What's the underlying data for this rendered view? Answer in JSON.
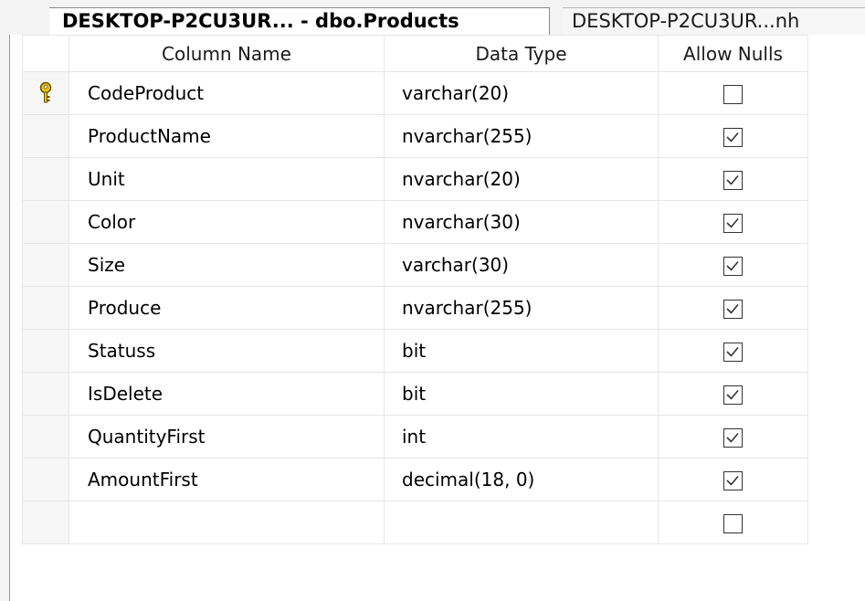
{
  "tabs": [
    {
      "label": "DESKTOP-P2CU3UR... - dbo.Products",
      "active": true
    },
    {
      "label": "DESKTOP-P2CU3UR...nh",
      "active": false
    }
  ],
  "columns": {
    "name_header": "Column Name",
    "type_header": "Data Type",
    "nulls_header": "Allow Nulls"
  },
  "rows": [
    {
      "name": "CodeProduct",
      "type": "varchar(20)",
      "allow_nulls": false,
      "primary_key": true,
      "key_icon": "primary-key-icon"
    },
    {
      "name": "ProductName",
      "type": "nvarchar(255)",
      "allow_nulls": true
    },
    {
      "name": "Unit",
      "type": "nvarchar(20)",
      "allow_nulls": true
    },
    {
      "name": "Color",
      "type": "nvarchar(30)",
      "allow_nulls": true
    },
    {
      "name": "Size",
      "type": "varchar(30)",
      "allow_nulls": true
    },
    {
      "name": "Produce",
      "type": "nvarchar(255)",
      "allow_nulls": true
    },
    {
      "name": "Statuss",
      "type": "bit",
      "allow_nulls": true
    },
    {
      "name": "IsDelete",
      "type": "bit",
      "allow_nulls": true
    },
    {
      "name": "QuantityFirst",
      "type": "int",
      "allow_nulls": true
    },
    {
      "name": "AmountFirst",
      "type": "decimal(18, 0)",
      "allow_nulls": true
    },
    {
      "name": "",
      "type": "",
      "allow_nulls": false
    }
  ],
  "colors": {
    "key_gold": "#e8c21a",
    "border": "#e6e6e6"
  }
}
